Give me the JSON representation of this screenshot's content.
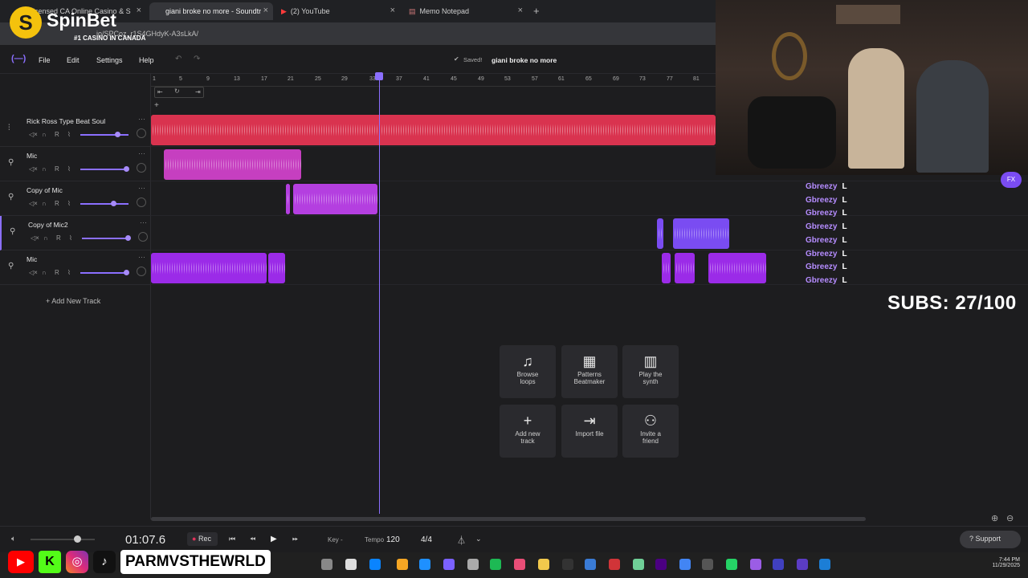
{
  "browser": {
    "tabs": [
      {
        "label": "Licensed CA Online Casino & S"
      },
      {
        "label": "giani broke no more - Soundtr"
      },
      {
        "label": "(2) YouTube"
      },
      {
        "label": "Memo Notepad"
      }
    ],
    "url": "io/SPCoz_r1S4GHdyK-A3sLkA/"
  },
  "overlay_brand": {
    "name": "SpinBet",
    "tagline": "#1 CASINO IN CANADA"
  },
  "app": {
    "menu": [
      "File",
      "Edit",
      "Settings",
      "Help"
    ],
    "save_status": "Saved!",
    "project_name": "giani broke no more"
  },
  "ruler_ticks": [
    "1",
    "5",
    "9",
    "13",
    "17",
    "21",
    "25",
    "29",
    "33",
    "37",
    "41",
    "45",
    "49",
    "53",
    "57",
    "61",
    "65",
    "69",
    "73",
    "77",
    "81"
  ],
  "tracks": [
    {
      "name": "Rick Ross Type Beat Soul",
      "icon": "waveform-icon",
      "color": "#d9334f"
    },
    {
      "name": "Mic",
      "icon": "mic-icon",
      "color": "#c63fc0"
    },
    {
      "name": "Copy of Mic",
      "icon": "mic-icon",
      "color": "#b43fe0"
    },
    {
      "name": "Copy of Mic2",
      "icon": "mic-icon",
      "color": "#7a4cf2"
    },
    {
      "name": "Mic",
      "icon": "mic-icon",
      "color": "#9b2be8"
    }
  ],
  "track_controls": {
    "record": "R"
  },
  "add_track_label": "Add New Track",
  "actions": [
    {
      "label1": "Browse",
      "label2": "loops",
      "icon": "music-note-icon"
    },
    {
      "label1": "Patterns",
      "label2": "Beatmaker",
      "icon": "grid-icon"
    },
    {
      "label1": "Play the",
      "label2": "synth",
      "icon": "piano-icon"
    },
    {
      "label1": "Add new",
      "label2": "track",
      "icon": "plus-icon"
    },
    {
      "label1": "Import file",
      "label2": "",
      "icon": "import-icon"
    },
    {
      "label1": "Invite a",
      "label2": "friend",
      "icon": "add-user-icon"
    }
  ],
  "transport": {
    "time": "01:07.6",
    "rec": "Rec",
    "key_label": "Key",
    "key_value": "-",
    "tempo_label": "Tempo",
    "tempo_value": "120",
    "time_signature": "4/4",
    "support": "Support"
  },
  "chat": [
    {
      "user": "Gbreezy",
      "msg": "L"
    },
    {
      "user": "Gbreezy",
      "msg": "L"
    },
    {
      "user": "Gbreezy",
      "msg": "L"
    },
    {
      "user": "Gbreezy",
      "msg": "L"
    },
    {
      "user": "Gbreezy",
      "msg": "L"
    },
    {
      "user": "Gbreezy",
      "msg": "L"
    },
    {
      "user": "Gbreezy",
      "msg": "L"
    },
    {
      "user": "Gbreezy",
      "msg": "L"
    }
  ],
  "subs_counter": "SUBS: 27/100",
  "stream_handle": "PARMVSTHEWRLD",
  "clock": {
    "time": "7:44 PM",
    "date": "11/29/2025"
  }
}
